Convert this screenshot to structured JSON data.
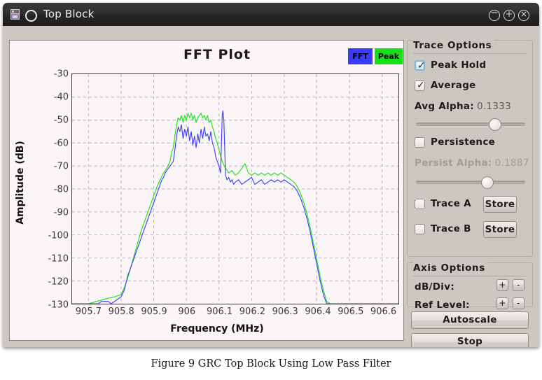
{
  "window": {
    "title": "Top Block",
    "icons": {
      "app": "app-icon",
      "circle": "circle-icon",
      "minimize": "−",
      "maximize": "+",
      "close": "×"
    }
  },
  "plot": {
    "title": "FFT  Plot",
    "legend": [
      {
        "label": "FFT",
        "color": "#3b3bff"
      },
      {
        "label": "Peak",
        "color": "#18e018"
      }
    ],
    "xlabel": "Frequency  (MHz)",
    "ylabel": "Amplitude  (dB)"
  },
  "controls": {
    "trace_options": {
      "title": "Trace  Options",
      "peak_hold": {
        "label": "Peak Hold",
        "checked": true,
        "focused": true
      },
      "average": {
        "label": "Average",
        "checked": true,
        "focused": false
      },
      "avg_alpha": {
        "label": "Avg Alpha:",
        "value": "0.1333",
        "slider_pct": 72
      },
      "persistence": {
        "label": "Persistence",
        "checked": false
      },
      "persist_alpha": {
        "label": "Persist Alpha:",
        "value": "0.1887",
        "slider_pct": 65,
        "enabled": false
      },
      "trace_a": {
        "label": "Trace A",
        "checked": false,
        "button": "Store"
      },
      "trace_b": {
        "label": "Trace B",
        "checked": false,
        "button": "Store"
      }
    },
    "axis_options": {
      "title": "Axis  Options",
      "db_div": {
        "label": "dB/Div:",
        "plus": "+",
        "minus": "-"
      },
      "ref_level": {
        "label": "Ref Level:",
        "plus": "+",
        "minus": "-"
      }
    },
    "autoscale_label": "Autoscale",
    "stop_label": "Stop"
  },
  "caption": "Figure 9 GRC Top Block Using Low Pass Filter",
  "chart_data": {
    "type": "line",
    "title": "FFT  Plot",
    "xlabel": "Frequency  (MHz)",
    "ylabel": "Amplitude  (dB)",
    "xlim": [
      905.65,
      906.65
    ],
    "ylim": [
      -130,
      -30
    ],
    "xticks": [
      "905.7",
      "905.8",
      "905.9",
      "906",
      "906.1",
      "906.2",
      "906.3",
      "906.4",
      "906.5",
      "906.6"
    ],
    "xtick_values": [
      905.7,
      905.8,
      905.9,
      906.0,
      906.1,
      906.2,
      906.3,
      906.4,
      906.5,
      906.6
    ],
    "yticks": [
      "-30",
      "-40",
      "-50",
      "-60",
      "-70",
      "-80",
      "-90",
      "-100",
      "-110",
      "-120",
      "-130"
    ],
    "ytick_values": [
      -30,
      -40,
      -50,
      -60,
      -70,
      -80,
      -90,
      -100,
      -110,
      -120,
      -130
    ],
    "grid": true,
    "legend_position": "top-right",
    "series": [
      {
        "name": "FFT",
        "color": "#3b3bff",
        "x": [
          905.65,
          905.66,
          905.67,
          905.68,
          905.69,
          905.7,
          905.71,
          905.72,
          905.73,
          905.74,
          905.75,
          905.76,
          905.77,
          905.78,
          905.79,
          905.8,
          905.81,
          905.815,
          905.82,
          905.825,
          905.83,
          905.835,
          905.84,
          905.845,
          905.85,
          905.855,
          905.86,
          905.865,
          905.87,
          905.875,
          905.88,
          905.885,
          905.89,
          905.895,
          905.9,
          905.905,
          905.91,
          905.915,
          905.92,
          905.925,
          905.93,
          905.935,
          905.94,
          905.945,
          905.95,
          905.955,
          905.96,
          905.965,
          905.97,
          905.975,
          905.98,
          905.985,
          905.99,
          905.995,
          906.0,
          906.005,
          906.01,
          906.015,
          906.02,
          906.025,
          906.03,
          906.035,
          906.04,
          906.045,
          906.05,
          906.055,
          906.06,
          906.065,
          906.07,
          906.075,
          906.08,
          906.085,
          906.09,
          906.095,
          906.1,
          906.105,
          906.11,
          906.112,
          906.115,
          906.12,
          906.125,
          906.13,
          906.135,
          906.14,
          906.145,
          906.15,
          906.16,
          906.17,
          906.18,
          906.19,
          906.2,
          906.21,
          906.22,
          906.23,
          906.24,
          906.25,
          906.26,
          906.27,
          906.28,
          906.29,
          906.3,
          906.31,
          906.32,
          906.33,
          906.34,
          906.35,
          906.36,
          906.37,
          906.38,
          906.39,
          906.4,
          906.41,
          906.42,
          906.43,
          906.44,
          906.45,
          906.5,
          906.55,
          906.6,
          906.65
        ],
        "y": [
          -130,
          -130,
          -130,
          -130,
          -130,
          -130,
          -130,
          -130,
          -130,
          -129,
          -129,
          -129,
          -130,
          -129,
          -128,
          -127,
          -124,
          -121,
          -118,
          -116,
          -114,
          -112,
          -110,
          -108,
          -106,
          -104,
          -102,
          -100,
          -98,
          -96,
          -94,
          -92,
          -90,
          -88,
          -86,
          -84,
          -82,
          -80,
          -78,
          -76,
          -75,
          -73,
          -72,
          -71,
          -70,
          -69,
          -68,
          -63,
          -57,
          -53,
          -55,
          -52,
          -58,
          -54,
          -57,
          -53,
          -59,
          -55,
          -61,
          -57,
          -62,
          -56,
          -60,
          -54,
          -58,
          -53,
          -57,
          -56,
          -59,
          -55,
          -60,
          -62,
          -66,
          -68,
          -70,
          -73,
          -48,
          -46,
          -50,
          -74,
          -76,
          -75,
          -77,
          -76,
          -78,
          -77,
          -76,
          -78,
          -77,
          -76,
          -75,
          -78,
          -77,
          -76,
          -78,
          -77,
          -76,
          -77,
          -76,
          -77,
          -76,
          -77,
          -78,
          -79,
          -81,
          -84,
          -88,
          -93,
          -99,
          -106,
          -113,
          -120,
          -126,
          -130,
          -130,
          -130,
          -130,
          -130,
          -130,
          -130
        ]
      },
      {
        "name": "Peak",
        "color": "#18e018",
        "x": [
          905.65,
          905.7,
          905.75,
          905.78,
          905.8,
          905.81,
          905.82,
          905.83,
          905.84,
          905.85,
          905.86,
          905.87,
          905.88,
          905.89,
          905.9,
          905.91,
          905.92,
          905.93,
          905.94,
          905.95,
          905.955,
          905.96,
          905.965,
          905.97,
          905.975,
          905.98,
          905.985,
          905.99,
          905.995,
          906.0,
          906.005,
          906.01,
          906.015,
          906.02,
          906.025,
          906.03,
          906.035,
          906.04,
          906.045,
          906.05,
          906.055,
          906.06,
          906.065,
          906.07,
          906.075,
          906.08,
          906.085,
          906.09,
          906.095,
          906.1,
          906.11,
          906.12,
          906.13,
          906.14,
          906.15,
          906.16,
          906.17,
          906.18,
          906.19,
          906.2,
          906.21,
          906.22,
          906.23,
          906.24,
          906.25,
          906.26,
          906.27,
          906.28,
          906.29,
          906.3,
          906.31,
          906.32,
          906.33,
          906.34,
          906.35,
          906.36,
          906.37,
          906.38,
          906.39,
          906.4,
          906.41,
          906.42,
          906.43,
          906.44,
          906.5,
          906.6,
          906.65
        ],
        "y": [
          -130,
          -130,
          -128,
          -127,
          -126,
          -123,
          -119,
          -114,
          -109,
          -104,
          -99,
          -95,
          -91,
          -87,
          -83,
          -79,
          -76,
          -73,
          -71,
          -68,
          -64,
          -62,
          -57,
          -52,
          -49,
          -50,
          -48,
          -51,
          -48,
          -50,
          -47,
          -49,
          -47,
          -50,
          -48,
          -51,
          -49,
          -48,
          -47,
          -49,
          -48,
          -50,
          -48,
          -51,
          -50,
          -53,
          -55,
          -58,
          -60,
          -63,
          -68,
          -71,
          -73,
          -72,
          -74,
          -73,
          -71,
          -69,
          -73,
          -74,
          -73,
          -74,
          -73,
          -74,
          -73,
          -74,
          -73,
          -74,
          -73,
          -74,
          -75,
          -76,
          -77,
          -79,
          -82,
          -86,
          -91,
          -97,
          -104,
          -111,
          -118,
          -124,
          -129,
          -130,
          -130,
          -130,
          -130
        ]
      }
    ]
  }
}
